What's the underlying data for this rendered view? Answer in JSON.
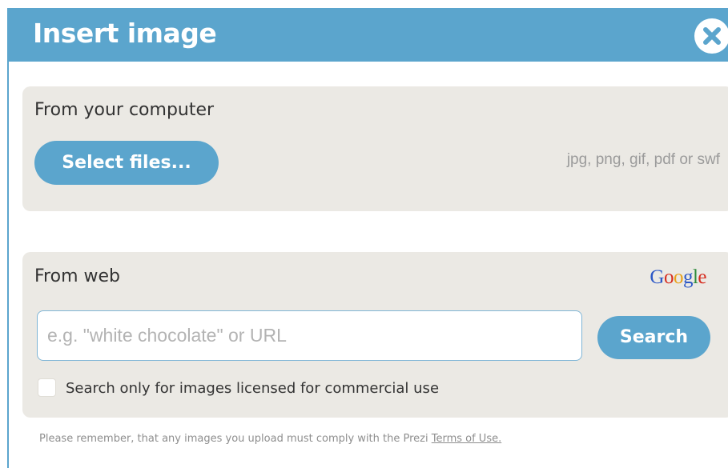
{
  "dialog": {
    "title": "Insert image",
    "close_icon": "close-icon"
  },
  "computer": {
    "heading": "From your computer",
    "select_label": "Select files...",
    "formats": "jpg, png, gif, pdf or swf"
  },
  "web": {
    "heading": "From web",
    "provider_logo": "Google",
    "search_placeholder": "e.g. \"white chocolate\" or URL",
    "search_value": "",
    "search_label": "Search",
    "commercial_label": "Search only for images licensed for commercial use",
    "commercial_checked": false
  },
  "footer": {
    "text": "Please remember, that any images you upload must comply with the Prezi",
    "link": "Terms of Use."
  },
  "colors": {
    "accent": "#5ba5cd",
    "panel": "#ebe9e4"
  }
}
